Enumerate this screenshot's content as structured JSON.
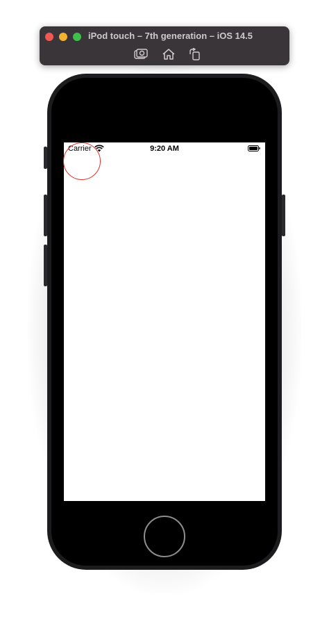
{
  "window": {
    "title": "iPod touch – 7th generation – iOS 14.5",
    "toolbar": {
      "screenshot_icon": "camera-screenshot-icon",
      "home_icon": "house-icon",
      "rotate_icon": "rotate-device-icon"
    }
  },
  "status_bar": {
    "carrier": "Carrier",
    "time": "9:20 AM",
    "wifi_icon": "wifi-icon",
    "battery_icon": "battery-full-icon"
  },
  "colors": {
    "titlebar_bg": "#3a3539",
    "close": "#ee5a52",
    "minimize": "#f2b331",
    "zoom": "#3ec04a",
    "touch_indicator": "#e0302a",
    "device_body": "#1c1c1e",
    "screen_bg": "#ffffff"
  }
}
